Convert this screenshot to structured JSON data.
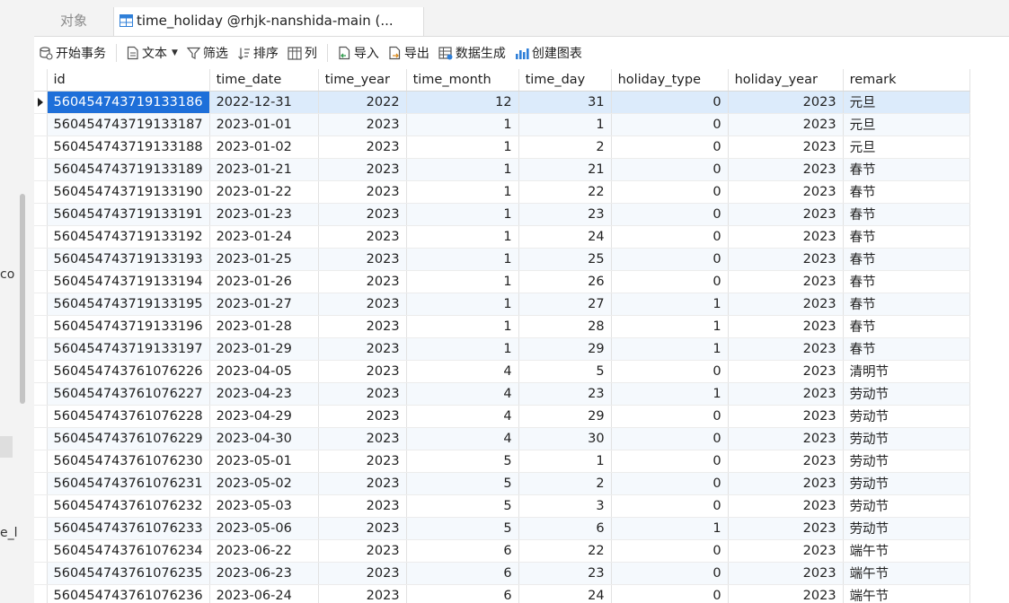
{
  "left_panel": {
    "fragments": [
      "co",
      "e_l"
    ]
  },
  "tabs": [
    {
      "label": "对象",
      "active": false
    },
    {
      "label": "time_holiday @rhjk-nanshida-main (...",
      "active": true
    }
  ],
  "toolbar": {
    "begin_transaction": "开始事务",
    "text": "文本",
    "filter": "筛选",
    "sort": "排序",
    "columns": "列",
    "import": "导入",
    "export": "导出",
    "data_generation": "数据生成",
    "create_chart": "创建图表"
  },
  "grid": {
    "columns": [
      "id",
      "time_date",
      "time_year",
      "time_month",
      "time_day",
      "holiday_type",
      "holiday_year",
      "remark"
    ],
    "selected_row": 0,
    "rows": [
      [
        "560454743719133186",
        "2022-12-31",
        "2022",
        "12",
        "31",
        "0",
        "2023",
        "元旦"
      ],
      [
        "560454743719133187",
        "2023-01-01",
        "2023",
        "1",
        "1",
        "0",
        "2023",
        "元旦"
      ],
      [
        "560454743719133188",
        "2023-01-02",
        "2023",
        "1",
        "2",
        "0",
        "2023",
        "元旦"
      ],
      [
        "560454743719133189",
        "2023-01-21",
        "2023",
        "1",
        "21",
        "0",
        "2023",
        "春节"
      ],
      [
        "560454743719133190",
        "2023-01-22",
        "2023",
        "1",
        "22",
        "0",
        "2023",
        "春节"
      ],
      [
        "560454743719133191",
        "2023-01-23",
        "2023",
        "1",
        "23",
        "0",
        "2023",
        "春节"
      ],
      [
        "560454743719133192",
        "2023-01-24",
        "2023",
        "1",
        "24",
        "0",
        "2023",
        "春节"
      ],
      [
        "560454743719133193",
        "2023-01-25",
        "2023",
        "1",
        "25",
        "0",
        "2023",
        "春节"
      ],
      [
        "560454743719133194",
        "2023-01-26",
        "2023",
        "1",
        "26",
        "0",
        "2023",
        "春节"
      ],
      [
        "560454743719133195",
        "2023-01-27",
        "2023",
        "1",
        "27",
        "1",
        "2023",
        "春节"
      ],
      [
        "560454743719133196",
        "2023-01-28",
        "2023",
        "1",
        "28",
        "1",
        "2023",
        "春节"
      ],
      [
        "560454743719133197",
        "2023-01-29",
        "2023",
        "1",
        "29",
        "1",
        "2023",
        "春节"
      ],
      [
        "560454743761076226",
        "2023-04-05",
        "2023",
        "4",
        "5",
        "0",
        "2023",
        "清明节"
      ],
      [
        "560454743761076227",
        "2023-04-23",
        "2023",
        "4",
        "23",
        "1",
        "2023",
        "劳动节"
      ],
      [
        "560454743761076228",
        "2023-04-29",
        "2023",
        "4",
        "29",
        "0",
        "2023",
        "劳动节"
      ],
      [
        "560454743761076229",
        "2023-04-30",
        "2023",
        "4",
        "30",
        "0",
        "2023",
        "劳动节"
      ],
      [
        "560454743761076230",
        "2023-05-01",
        "2023",
        "5",
        "1",
        "0",
        "2023",
        "劳动节"
      ],
      [
        "560454743761076231",
        "2023-05-02",
        "2023",
        "5",
        "2",
        "0",
        "2023",
        "劳动节"
      ],
      [
        "560454743761076232",
        "2023-05-03",
        "2023",
        "5",
        "3",
        "0",
        "2023",
        "劳动节"
      ],
      [
        "560454743761076233",
        "2023-05-06",
        "2023",
        "5",
        "6",
        "1",
        "2023",
        "劳动节"
      ],
      [
        "560454743761076234",
        "2023-06-22",
        "2023",
        "6",
        "22",
        "0",
        "2023",
        "端午节"
      ],
      [
        "560454743761076235",
        "2023-06-23",
        "2023",
        "6",
        "23",
        "0",
        "2023",
        "端午节"
      ],
      [
        "560454743761076236",
        "2023-06-24",
        "2023",
        "6",
        "24",
        "0",
        "2023",
        "端午节"
      ]
    ]
  },
  "colors": {
    "selection": "#1e6fd9",
    "selected_row": "#dcebfb",
    "alt_row": "#f5f9fd"
  }
}
